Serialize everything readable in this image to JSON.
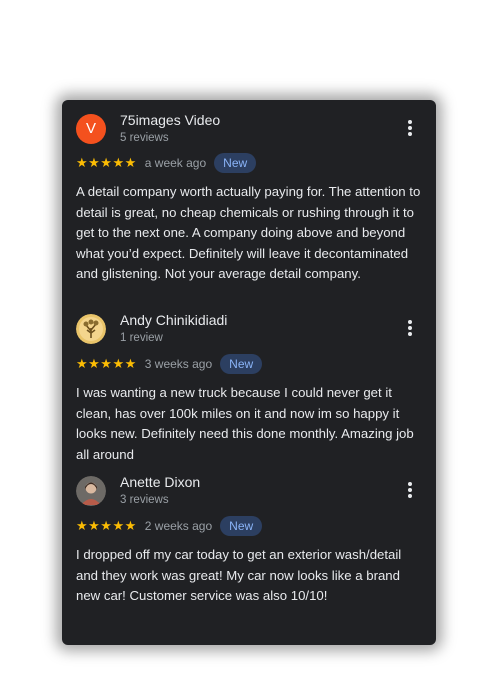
{
  "reviews": [
    {
      "avatar_letter": "V",
      "avatar_color": "#f4511e",
      "name": "75images Video",
      "review_count": "5 reviews",
      "stars": "★★★★★",
      "rating": 5,
      "time": "a week ago",
      "badge": "New",
      "text": "A detail company worth actually paying for. The attention to detail is great, no cheap chemicals or rushing through it to get to the next one. A company doing above and beyond what you’d expect. Definitely will leave it decontaminated and glistening. Not your average detail company."
    },
    {
      "avatar_icon": "tree-photo-avatar",
      "name": "Andy Chinikidiadi",
      "review_count": "1 review",
      "stars": "★★★★★",
      "rating": 5,
      "time": "3 weeks ago",
      "badge": "New",
      "text": "I was wanting a new truck because I could never get it clean, has over 100k miles on it and now im so happy it looks new. Definitely need this done monthly. Amazing job all around"
    },
    {
      "avatar_icon": "person-photo-avatar",
      "name": "Anette Dixon",
      "review_count": "3 reviews",
      "stars": "★★★★★",
      "rating": 5,
      "time": "2 weeks ago",
      "badge": "New",
      "text": "I dropped off my car today to get an exterior wash/detail and they work was great! My car now looks like a brand new car! Customer service was also 10/10!"
    }
  ],
  "colors": {
    "card_background": "#202124",
    "star": "#fbbc04",
    "badge_background": "#2c3f61",
    "badge_text": "#8ab4f8",
    "primary_text": "#e8eaed",
    "secondary_text": "#9aa0a6"
  },
  "icons": {
    "more_menu": "more-vert-icon"
  }
}
